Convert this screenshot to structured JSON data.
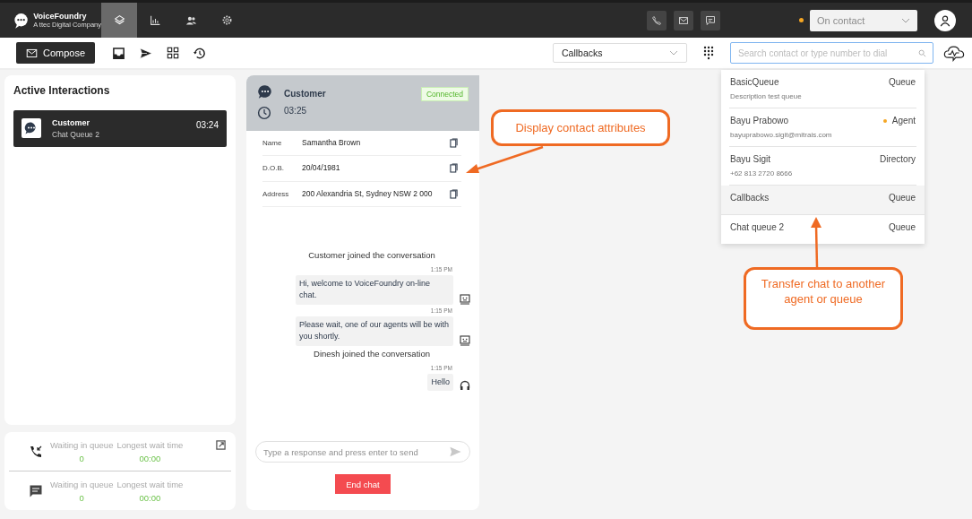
{
  "brand": {
    "name": "VoiceFoundry",
    "tagline": "A ttec Digital Company"
  },
  "nav_tabs": [
    {
      "selected": true
    },
    {
      "selected": false
    },
    {
      "selected": false
    },
    {
      "selected": false
    }
  ],
  "status": {
    "color": "#f5a623",
    "value": "On contact"
  },
  "toolbar": {
    "compose": "Compose",
    "queue_select": "Callbacks",
    "search_placeholder": "Search contact or type number to dial"
  },
  "active_interactions": {
    "title": "Active Interactions",
    "items": [
      {
        "name": "Customer",
        "queue": "Chat Queue 2",
        "time": "03:24",
        "selected": true
      }
    ]
  },
  "queue_stats": [
    {
      "kind": "call",
      "waiting_label": "Waiting in queue",
      "waiting": "0",
      "longest_label": "Longest wait time",
      "longest": "00:00"
    },
    {
      "kind": "chat",
      "waiting_label": "Waiting in queue",
      "waiting": "0",
      "longest_label": "Longest wait time",
      "longest": "00:00"
    }
  ],
  "chat": {
    "name": "Customer",
    "timer": "03:25",
    "status": "Connected",
    "attributes": [
      {
        "label": "Name",
        "value": "Samantha Brown"
      },
      {
        "label": "D.O.B.",
        "value": "20/04/1981"
      },
      {
        "label": "Address",
        "value": "200 Alexandria St, Sydney NSW 2 000"
      }
    ],
    "messages": [
      {
        "kind": "event",
        "text": "Customer joined the conversation"
      },
      {
        "kind": "bot",
        "time": "1:15 PM",
        "text": "Hi, welcome to VoiceFoundry on-line chat."
      },
      {
        "kind": "bot",
        "time": "1:15 PM",
        "text": "Please wait, one of our agents will be with you shortly."
      },
      {
        "kind": "event",
        "text": "Dinesh joined the conversation"
      },
      {
        "kind": "agent",
        "time": "1:15 PM",
        "text": "Hello"
      }
    ],
    "input_placeholder": "Type a response and press enter to send",
    "end_button": "End chat"
  },
  "search_results": [
    {
      "name": "BasicQueue",
      "detail": "Description test queue",
      "type": "Queue",
      "selected": false
    },
    {
      "name": "Bayu Prabowo",
      "detail": "bayuprabowo.sigit@mitrais.com",
      "type": "Agent",
      "color": "#f5a623",
      "selected": false
    },
    {
      "name": "Bayu Sigit",
      "detail": "+62 813 2720 8666",
      "type": "Directory",
      "selected": false
    },
    {
      "name": "Callbacks",
      "type": "Queue",
      "selected": true
    },
    {
      "name": "Chat queue 2",
      "type": "Queue",
      "selected": false
    }
  ],
  "annotations": [
    {
      "text": "Display contact attributes"
    },
    {
      "text": "Transfer chat to another agent or queue"
    }
  ]
}
